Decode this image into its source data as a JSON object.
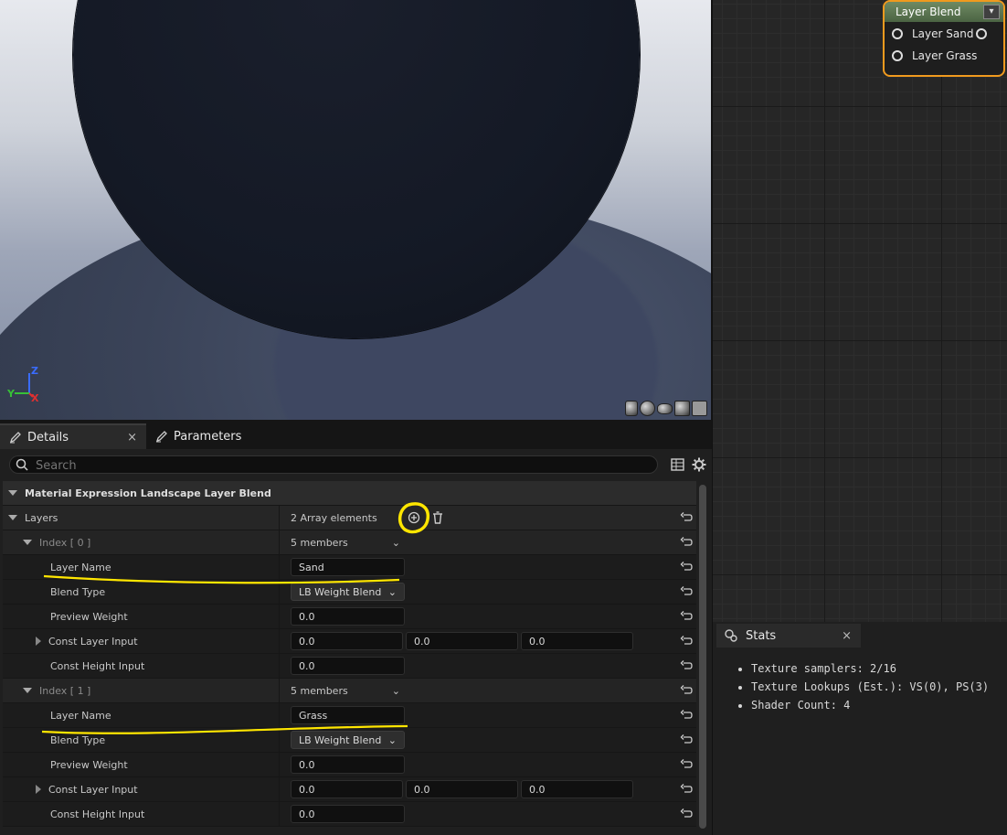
{
  "viewport": {
    "axes": {
      "z": "Z",
      "y": "Y",
      "x": "X"
    },
    "tools": [
      "cylinder-preview-icon",
      "sphere-preview-icon",
      "plane-preview-icon",
      "cube-preview-icon",
      "mesh-preview-icon"
    ]
  },
  "graph_node": {
    "title": "Layer Blend",
    "pins": [
      "Layer Sand",
      "Layer Grass"
    ]
  },
  "details": {
    "tabs": [
      {
        "label": "Details",
        "close": "×"
      },
      {
        "label": "Parameters"
      }
    ],
    "search": {
      "placeholder": "Search"
    },
    "category": "Material Expression Landscape Layer Blend",
    "layers": {
      "label": "Layers",
      "value": "2 Array elements"
    },
    "indices": [
      {
        "label": "Index [ 0 ]",
        "members": "5 members",
        "layer_name_label": "Layer Name",
        "layer_name": "Sand",
        "blend_type_label": "Blend Type",
        "blend_type": "LB Weight Blend",
        "preview_weight_label": "Preview Weight",
        "preview_weight": "0.0",
        "const_layer_label": "Const Layer Input",
        "const_layer": [
          "0.0",
          "0.0",
          "0.0"
        ],
        "const_height_label": "Const Height Input",
        "const_height": "0.0"
      },
      {
        "label": "Index [ 1 ]",
        "members": "5 members",
        "layer_name_label": "Layer Name",
        "layer_name": "Grass",
        "blend_type_label": "Blend Type",
        "blend_type": "LB Weight Blend",
        "preview_weight_label": "Preview Weight",
        "preview_weight": "0.0",
        "const_layer_label": "Const Layer Input",
        "const_layer": [
          "0.0",
          "0.0",
          "0.0"
        ],
        "const_height_label": "Const Height Input",
        "const_height": "0.0"
      }
    ]
  },
  "stats": {
    "tab": "Stats",
    "close": "×",
    "items": [
      "Texture samplers: 2/16",
      "Texture Lookups (Est.): VS(0), PS(3)",
      "Shader Count: 4"
    ]
  },
  "colors": {
    "annotation": "#ffe600",
    "node_border": "#f09a1e",
    "node_header": "#5a7650"
  }
}
